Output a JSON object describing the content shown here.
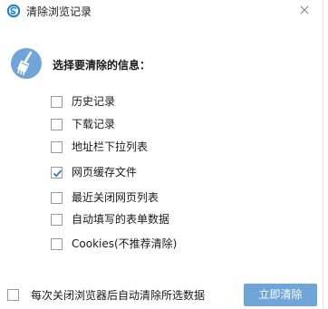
{
  "window": {
    "title": "清除浏览记录"
  },
  "main": {
    "heading": "选择要清除的信息："
  },
  "options": [
    {
      "label": "历史记录",
      "checked": false
    },
    {
      "label": "下载记录",
      "checked": false
    },
    {
      "label": "地址栏下拉列表",
      "checked": false
    },
    {
      "label": "网页缓存文件",
      "checked": true
    },
    {
      "label": "最近关闭网页列表",
      "checked": false
    },
    {
      "label": "自动填写的表单数据",
      "checked": false
    },
    {
      "label": "Cookies(不推荐清除)",
      "checked": false
    }
  ],
  "footer": {
    "auto_clear_label": "每次关闭浏览器后自动清除所选数据",
    "auto_clear_checked": false,
    "clear_button_label": "立即清除"
  },
  "colors": {
    "accent": "#6fa5d8",
    "brand": "#1f7fd1",
    "check": "#1f6fc0"
  },
  "icons": {
    "app": "browser-logo-icon",
    "close": "close-icon",
    "broom": "broom-icon",
    "check": "checkmark-icon"
  }
}
